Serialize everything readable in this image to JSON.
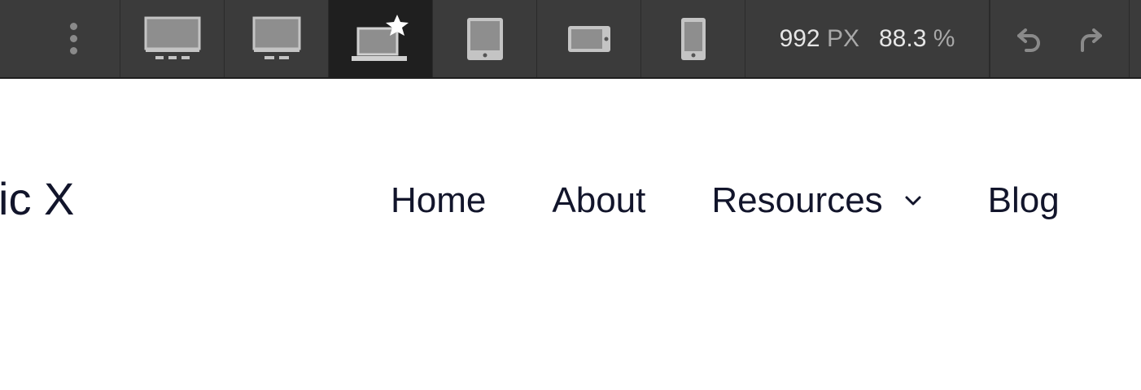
{
  "toolbar": {
    "devices": [
      {
        "name": "desktop-large",
        "icon": "desktop-large-icon"
      },
      {
        "name": "desktop",
        "icon": "desktop-icon"
      },
      {
        "name": "laptop-base",
        "icon": "laptop-star-icon",
        "active": true
      },
      {
        "name": "tablet",
        "icon": "tablet-icon"
      },
      {
        "name": "tablet-landscape",
        "icon": "tablet-landscape-icon"
      },
      {
        "name": "phone",
        "icon": "phone-icon"
      }
    ],
    "width_value": "992",
    "width_unit": "PX",
    "zoom_value": "88.3",
    "zoom_unit": "%"
  },
  "site": {
    "logo_text": "ic X",
    "nav": {
      "home": "Home",
      "about": "About",
      "resources": "Resources",
      "blog": "Blog"
    }
  },
  "colors": {
    "toolbar_bg": "#3b3b3b",
    "active_device_bg": "#1f1f1f",
    "nav_text": "#12152b"
  }
}
